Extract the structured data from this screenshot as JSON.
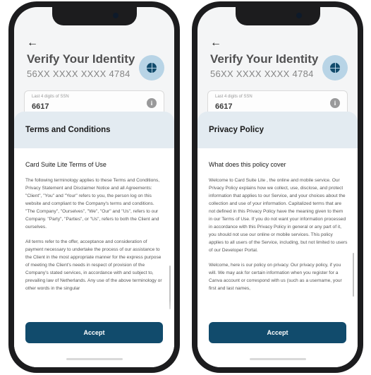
{
  "colors": {
    "accent": "#114b6c",
    "sheet_header": "#e3ebf1",
    "badge": "#b8d4e6"
  },
  "verify": {
    "back_icon": "back-arrow-icon",
    "title": "Verify Your Identity",
    "card_number": "56XX XXXX XXXX 4784",
    "ssn_label": "Last 4 digits of SSN",
    "ssn_value": "6617",
    "info_icon": "info-icon"
  },
  "terms": {
    "header": "Terms and Conditions",
    "subtitle": "Card Suite Lite  Terms of Use",
    "paragraphs": [
      "The following terminology applies to these Terms and Conditions, Privacy Statement and Disclaimer Notice and all Agreements: \"Client\", \"You\" and \"Your\" refers to you, the person log on this website and compliant to the Company's terms and conditions. \"The Company\", \"Ourselves\", \"We\", \"Our\" and \"Us\", refers to our Company. \"Party\", \"Parties\", or \"Us\", refers to both the Client and ourselves.",
      "All terms refer to the offer, acceptance and consideration of payment necessary to undertake the process of our assistance to the Client in the most appropriate manner for the express purpose of meeting the Client's needs in respect of provision of the Company's stated services, in accordance with and subject to, prevailing law of Netherlands. Any use of the above terminology or other words in the singular"
    ],
    "accept_label": "Accept"
  },
  "privacy": {
    "header": "Privacy Policy",
    "subtitle": "What does this policy cover",
    "paragraphs": [
      "Welcome to Card Suite Lite , the online and mobile service. Our Privacy Policy explains how we collect, use, disclose, and protect information that applies to our Service, and your choices about the collection and use of your information. Capitalized terms that are not defined in this Privacy Policy have the meaning given to them in our Terms of Use. If you do not want your information processed in accordance with this Privacy Policy in general or any part of it, you should not use our online or mobile services. This policy applies to all users of the Service, including, but not limited to users of our Developer Portal.",
      "Welcome, here is our policy on privacy. Our privacy policy, if you will. We may ask for certain information when you register for a Canva account or correspond with us (such as a username, your first and last names,"
    ],
    "accept_label": "Accept"
  }
}
